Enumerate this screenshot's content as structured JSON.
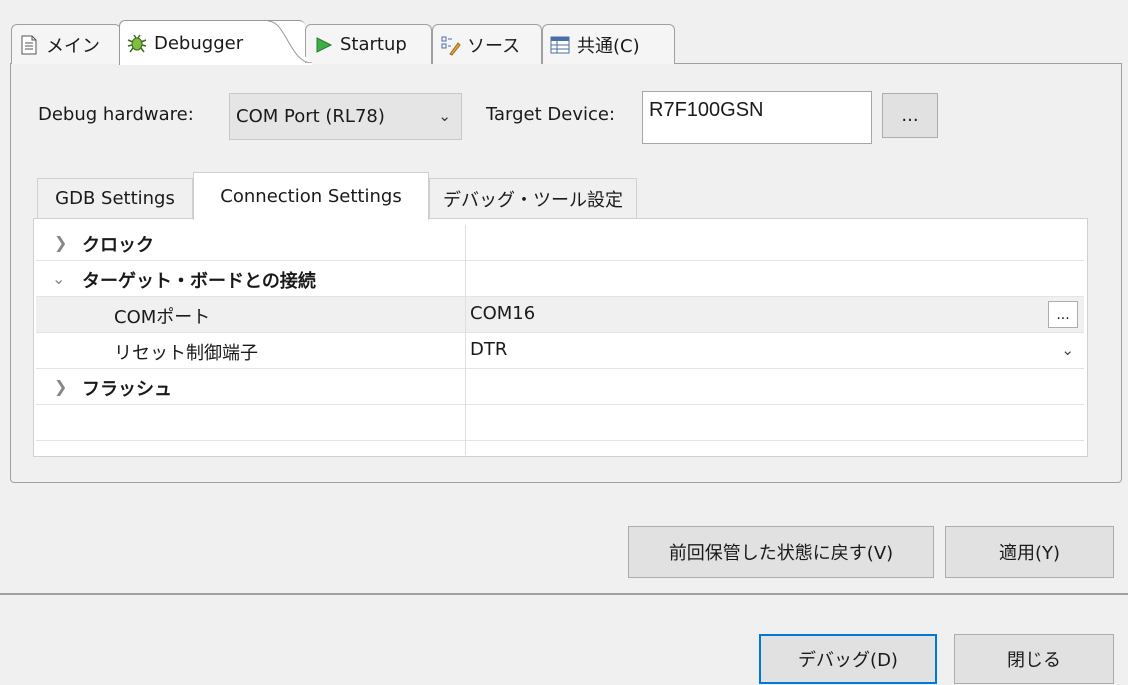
{
  "tabs": [
    {
      "label": "メイン",
      "icon": "main-file-icon"
    },
    {
      "label": "Debugger",
      "icon": "bug-icon"
    },
    {
      "label": "Startup",
      "icon": "run-arrow-icon"
    },
    {
      "label": "ソース",
      "icon": "source-lookup-icon"
    },
    {
      "label": "共通(C)",
      "icon": "common-table-icon"
    }
  ],
  "debugger": {
    "hardware_label": "Debug hardware:",
    "hardware_value": "COM Port (RL78)",
    "target_label": "Target Device:",
    "target_value": "R7F100GSN",
    "browse_label": "..."
  },
  "inner_tabs": [
    "GDB Settings",
    "Connection Settings",
    "デバッグ・ツール設定"
  ],
  "tree": {
    "rows": [
      {
        "name": "クロック",
        "value": ""
      },
      {
        "name": "ターゲット・ボードとの接続",
        "value": ""
      },
      {
        "name": "COMポート",
        "value": "COM16",
        "button": "..."
      },
      {
        "name": "リセット制御端子",
        "value": "DTR"
      },
      {
        "name": "フラッシュ",
        "value": ""
      }
    ]
  },
  "buttons": {
    "restore": "前回保管した状態に戻す(V)",
    "apply": "適用(Y)",
    "debug": "デバッグ(D)",
    "close": "閉じる"
  },
  "colors": {
    "focus_border": "#0078d7",
    "run_green": "#3cb043"
  }
}
